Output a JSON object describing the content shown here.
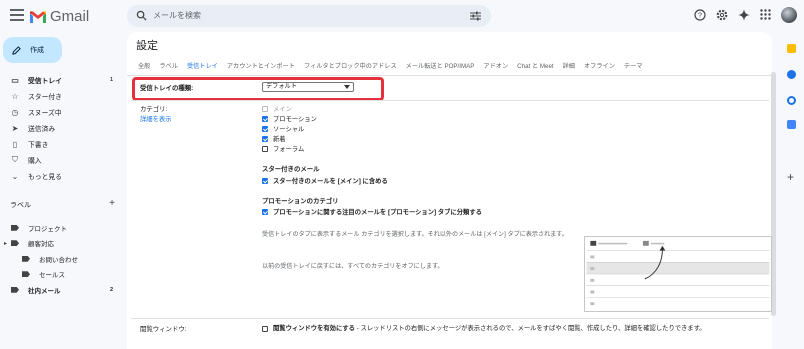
{
  "app": {
    "name": "Gmail"
  },
  "search": {
    "placeholder": "メールを検索"
  },
  "compose": {
    "label": "作成"
  },
  "nav": [
    {
      "label": "受信トレイ",
      "count": "1",
      "bold": true,
      "icon": "inbox-icon"
    },
    {
      "label": "スター付き",
      "count": "",
      "bold": false,
      "icon": "star-icon"
    },
    {
      "label": "スヌーズ中",
      "count": "",
      "bold": false,
      "icon": "clock-icon"
    },
    {
      "label": "送信済み",
      "count": "",
      "bold": false,
      "icon": "send-icon"
    },
    {
      "label": "下書き",
      "count": "",
      "bold": false,
      "icon": "draft-icon"
    },
    {
      "label": "購入",
      "count": "",
      "bold": false,
      "icon": "purchase-icon"
    },
    {
      "label": "もっと見る",
      "count": "",
      "bold": false,
      "icon": "chevron-down-icon"
    }
  ],
  "labels": {
    "heading": "ラベル",
    "items": [
      {
        "label": "プロジェクト",
        "count": "",
        "bold": false,
        "indent": 0
      },
      {
        "label": "顧客対応",
        "count": "",
        "bold": false,
        "indent": 0
      },
      {
        "label": "お問い合わせ",
        "count": "",
        "bold": false,
        "indent": 1
      },
      {
        "label": "セールス",
        "count": "",
        "bold": false,
        "indent": 1
      },
      {
        "label": "社内メール",
        "count": "2",
        "bold": true,
        "indent": 0
      }
    ]
  },
  "settings": {
    "title": "設定",
    "tabs": [
      "全般",
      "ラベル",
      "受信トレイ",
      "アカウントとインポート",
      "フィルタとブロック中のアドレス",
      "メール転送と POP/IMAP",
      "アドオン",
      "Chat と Meet",
      "詳細",
      "オフライン",
      "テーマ"
    ],
    "active_tab": 2,
    "inbox_type": {
      "label": "受信トレイの種類:",
      "value": "デフォルト"
    },
    "categories": {
      "label": "カテゴリ:",
      "link": "詳細を表示",
      "items": [
        {
          "label": "メイン",
          "checked": true,
          "disabled": true
        },
        {
          "label": "プロモーション",
          "checked": true,
          "disabled": false
        },
        {
          "label": "ソーシャル",
          "checked": true,
          "disabled": false
        },
        {
          "label": "新着",
          "checked": true,
          "disabled": false
        },
        {
          "label": "フォーラム",
          "checked": false,
          "disabled": false
        }
      ],
      "starred_heading": "スター付きのメール",
      "starred_option": "スター付きのメールを [メイン] に含める",
      "promo_heading": "プロモーションのカテゴリ",
      "promo_option": "プロモーションに関する注目のメールを [プロモーション] タブに分類する",
      "desc1": "受信トレイのタブに表示するメール カテゴリを選択します。それ以外のメールは [メイン] タブに表示されます。",
      "desc2": "以前の受信トレイに戻すには、すべてのカテゴリをオフにします。"
    },
    "reading_pane": {
      "label": "閲覧ウィンドウ:",
      "option_bold": "閲覧ウィンドウを有効にする",
      "option_rest": " - スレッドリストの右側にメッセージが表示されるので、メールをすばやく閲覧、作成したり、詳細を確認したりできます。"
    }
  },
  "colors": {
    "accent": "#1a73e8",
    "compose_bg": "#c2e7ff",
    "highlight_box": "#e5303d"
  }
}
